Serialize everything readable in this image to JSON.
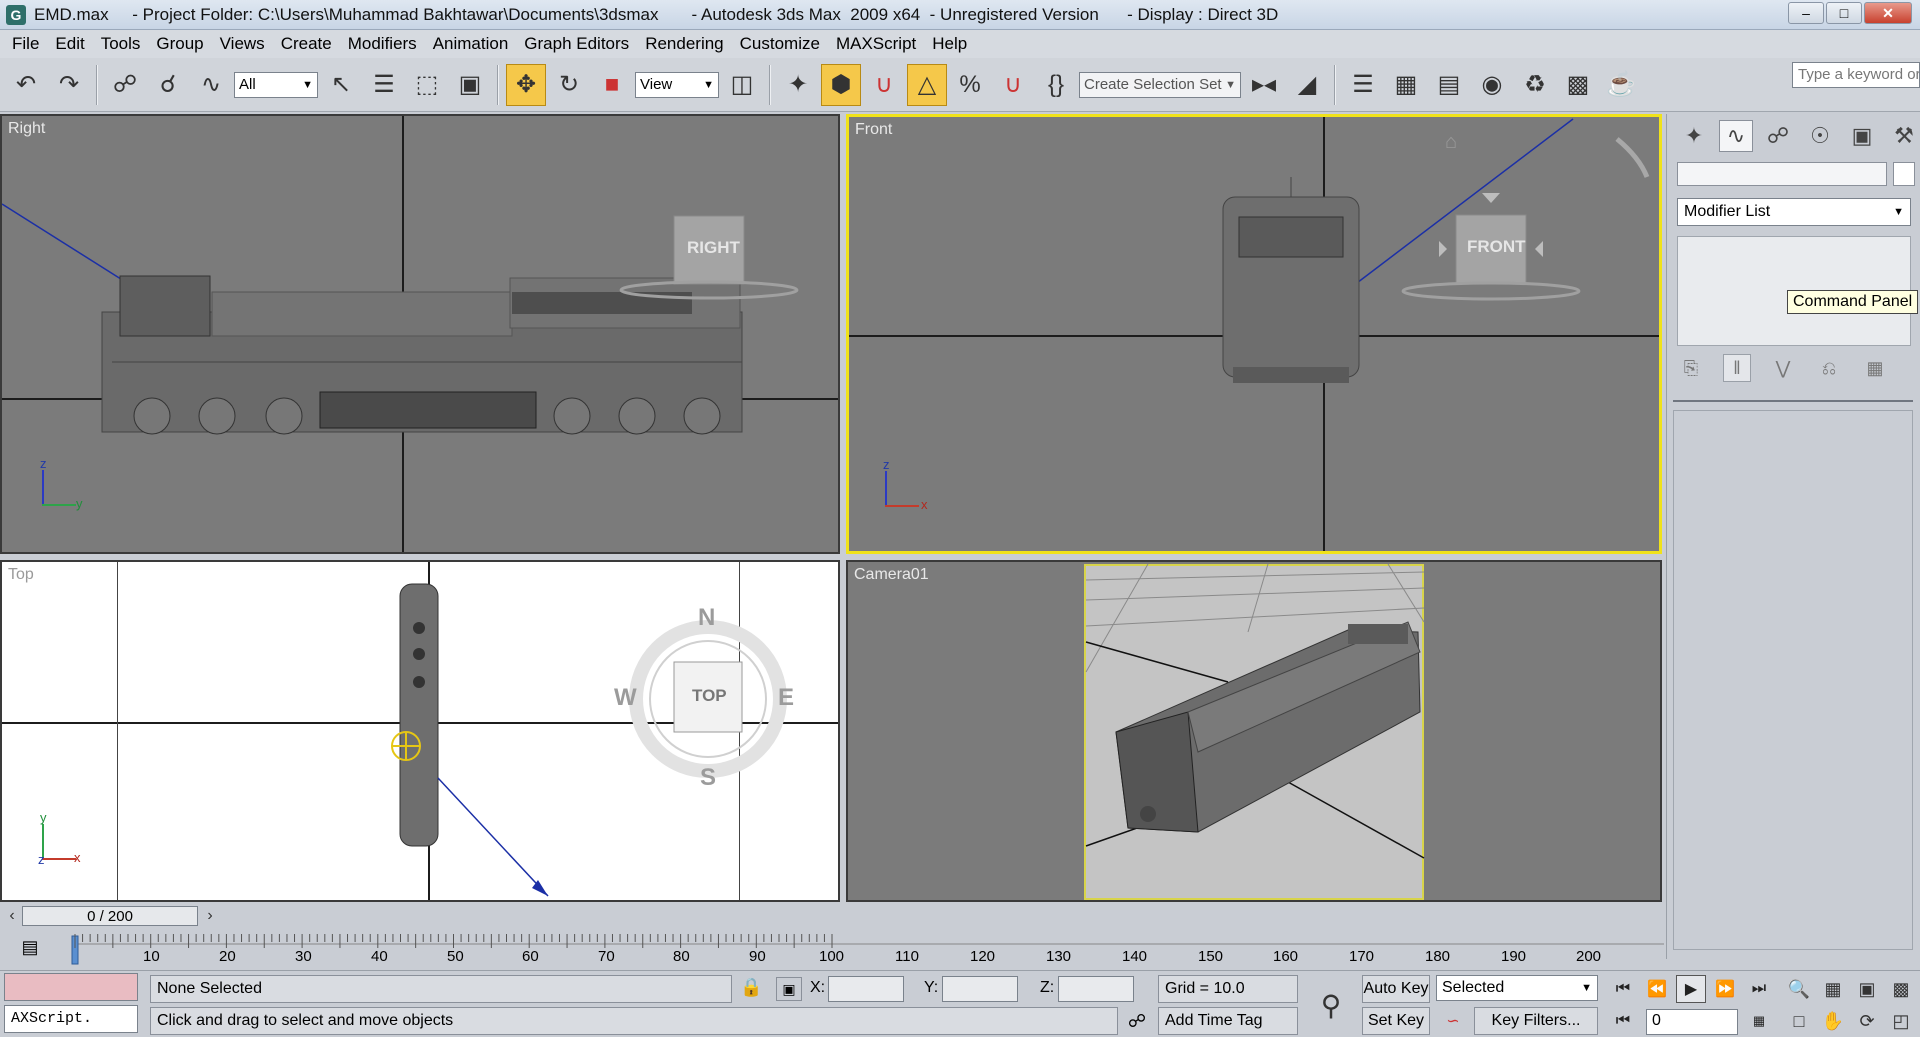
{
  "window": {
    "title": "EMD.max     - Project Folder: C:\\Users\\Muhammad Bakhtawar\\Documents\\3dsmax       - Autodesk 3ds Max  2009 x64  - Unregistered Version      - Display : Direct 3D",
    "app_icon": "G",
    "minimize": "–",
    "maximize": "□",
    "close": "✕"
  },
  "menu": {
    "items": [
      "File",
      "Edit",
      "Tools",
      "Group",
      "Views",
      "Create",
      "Modifiers",
      "Animation",
      "Graph Editors",
      "Rendering",
      "Customize",
      "MAXScript",
      "Help"
    ]
  },
  "toolbar": {
    "selection_filter": "All",
    "ref_coord": "View",
    "selection_set_placeholder": "Create Selection Set",
    "search_placeholder": "Type a keyword or"
  },
  "viewports": {
    "right": {
      "label": "Right",
      "viewcube": "RIGHT",
      "axis_v": "z",
      "axis_h": "y"
    },
    "front": {
      "label": "Front",
      "viewcube": "FRONT",
      "axis_v": "z",
      "axis_h": "x"
    },
    "top": {
      "label": "Top",
      "viewcube": "TOP",
      "compass": {
        "n": "N",
        "s": "S",
        "e": "E",
        "w": "W"
      },
      "axis_v": "y",
      "axis_h": "x",
      "axis_o": "z"
    },
    "camera": {
      "label": "Camera01"
    }
  },
  "command_panel": {
    "modifier_list": "Modifier List",
    "tooltip": "Command Panel"
  },
  "timeline": {
    "frame_display": "0 / 200",
    "ticks": [
      "10",
      "20",
      "30",
      "40",
      "50",
      "60",
      "70",
      "80",
      "90",
      "100",
      "110",
      "120",
      "130",
      "140",
      "150",
      "160",
      "170",
      "180",
      "190",
      "200"
    ]
  },
  "status": {
    "listener": "AXScript.",
    "selection": "None Selected",
    "prompt": "Click and drag to select and move objects",
    "x_label": "X:",
    "y_label": "Y:",
    "z_label": "Z:",
    "grid": "Grid = 10.0",
    "add_time_tag": "Add Time Tag",
    "auto_key": "Auto Key",
    "set_key": "Set Key",
    "selected_option": "Selected",
    "key_filters": "Key Filters...",
    "current_frame": "0"
  }
}
